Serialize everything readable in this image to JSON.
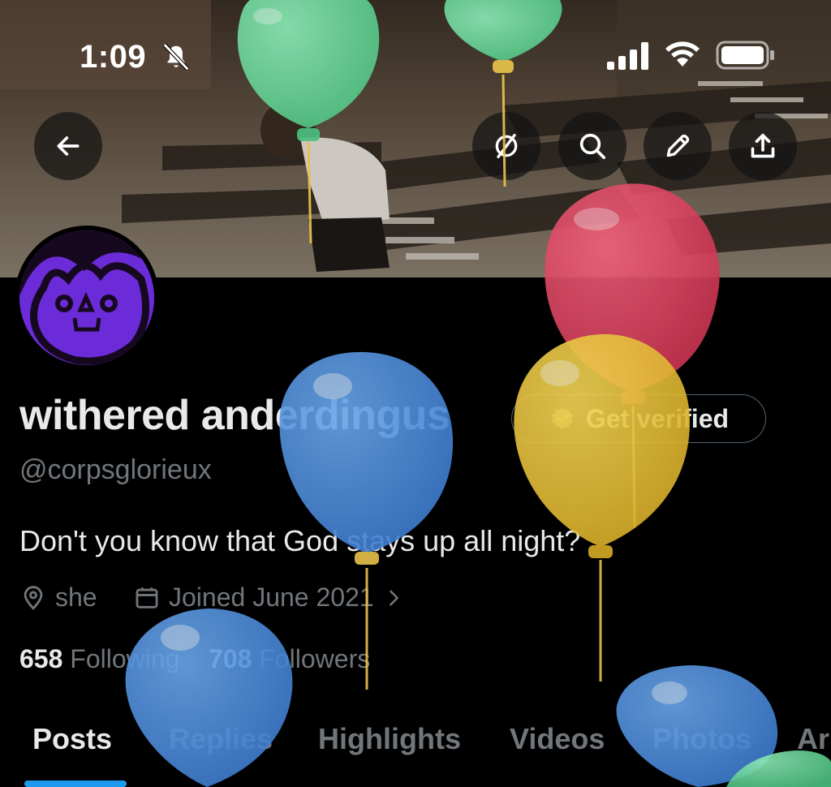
{
  "status_bar": {
    "time": "1:09"
  },
  "profile": {
    "display_name": "withered anderdingus",
    "handle": "@corpsglorieux",
    "bio": "Don't you know that God stays up all night?",
    "location": "she",
    "joined": "Joined June 2021",
    "following_count": "658",
    "following_label": "Following",
    "followers_count": "708",
    "followers_label": "Followers"
  },
  "verify_button": {
    "label": "Get verified"
  },
  "tabs": [
    "Posts",
    "Replies",
    "Highlights",
    "Videos",
    "Photos",
    "Ar"
  ],
  "colors": {
    "accent": "#1d9bf0",
    "avatar_purple": "#6b2bd9",
    "balloon_green": "#6fd39a",
    "balloon_red": "#e0405a",
    "balloon_yellow": "#e7c23c",
    "balloon_blue": "#4f8fdc"
  },
  "icons": {
    "back": "arrow-left-icon",
    "grok": "circle-slash-icon",
    "search": "search-icon",
    "edit": "pencil-icon",
    "share": "share-upload-icon"
  }
}
